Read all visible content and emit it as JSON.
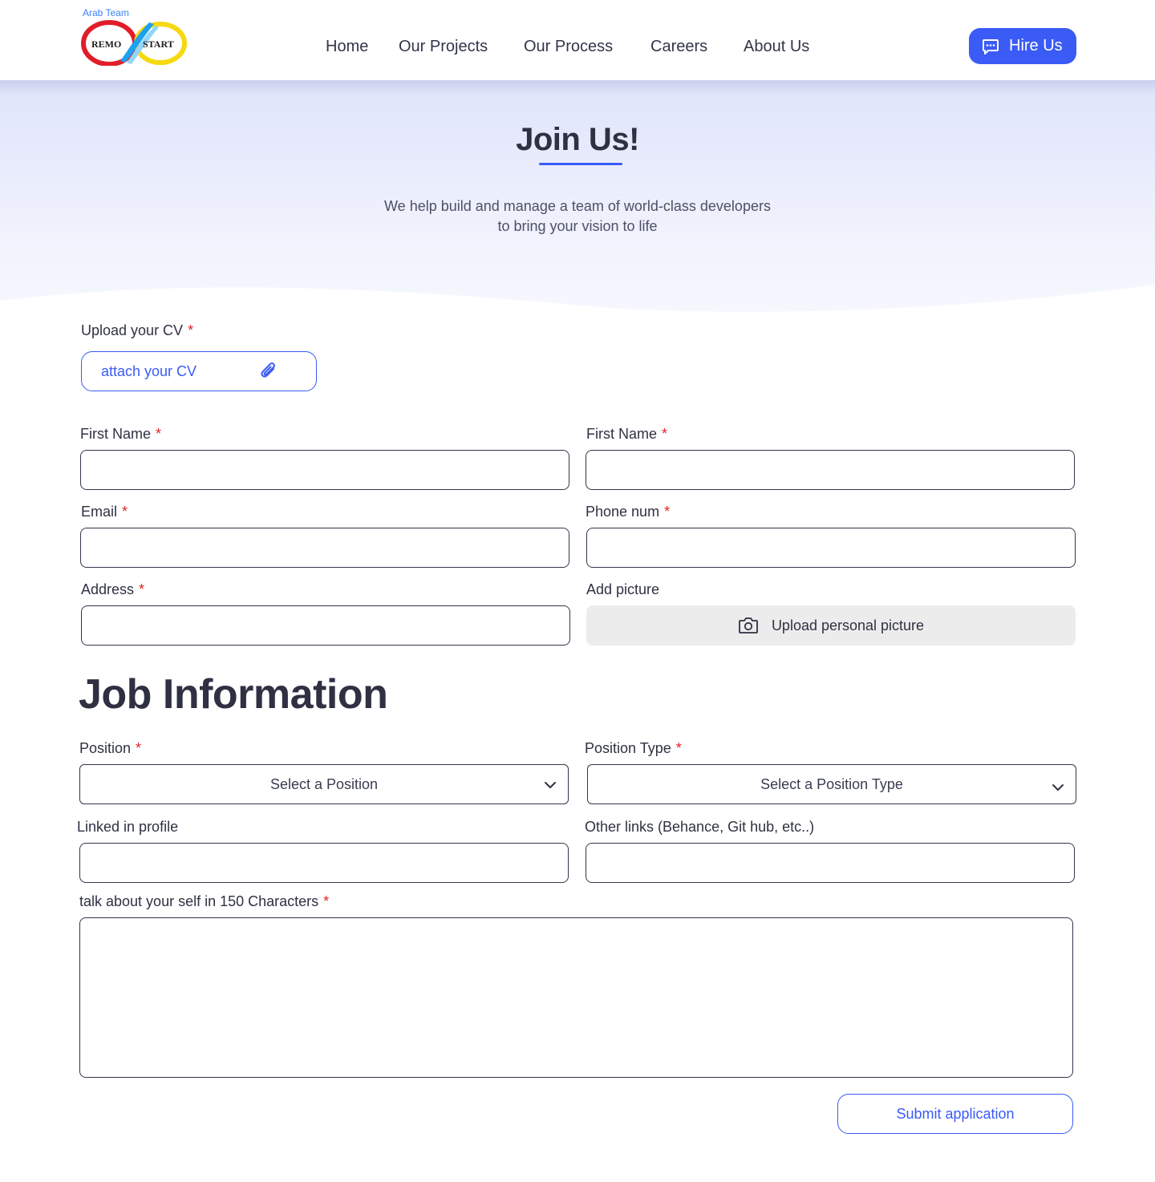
{
  "brand": {
    "tagline": "Arab Team",
    "logo_left": "REMO",
    "logo_right": "START"
  },
  "nav": {
    "items": [
      {
        "label": "Home"
      },
      {
        "label": "Our Projects"
      },
      {
        "label": "Our Process"
      },
      {
        "label": "Careers"
      },
      {
        "label": "About Us"
      }
    ],
    "hire_label": "Hire Us"
  },
  "hero": {
    "title": "Join Us!",
    "subtitle_line1": "We help build and manage a team of world-class developers",
    "subtitle_line2": "to bring your vision to life"
  },
  "form": {
    "required_mark": "*",
    "cv_label": "Upload your CV",
    "cv_button": "attach your CV",
    "first_name_label": "First Name",
    "first_name_label_2": "First Name",
    "email_label": "Email",
    "phone_label": "Phone num",
    "address_label": "Address",
    "picture_label": "Add picture",
    "picture_button": "Upload personal picture"
  },
  "job": {
    "section_title": "Job Information",
    "position_label": "Position",
    "position_value": "Select a Position",
    "position_type_label": "Position Type",
    "position_type_value": "Select a Position Type",
    "linkedin_label": "Linked in profile",
    "other_links_label": "Other links (Behance, Git hub, etc..)",
    "about_label": "talk about your self in 150 Characters",
    "submit_label": "Submit application"
  },
  "colors": {
    "accent": "#3b5bf6",
    "required": "#e02424",
    "text": "#2f3142"
  },
  "icons": {
    "hire": "chat-bubble-icon",
    "attach": "paperclip-icon",
    "camera": "camera-icon",
    "dropdown": "chevron-down-icon"
  }
}
